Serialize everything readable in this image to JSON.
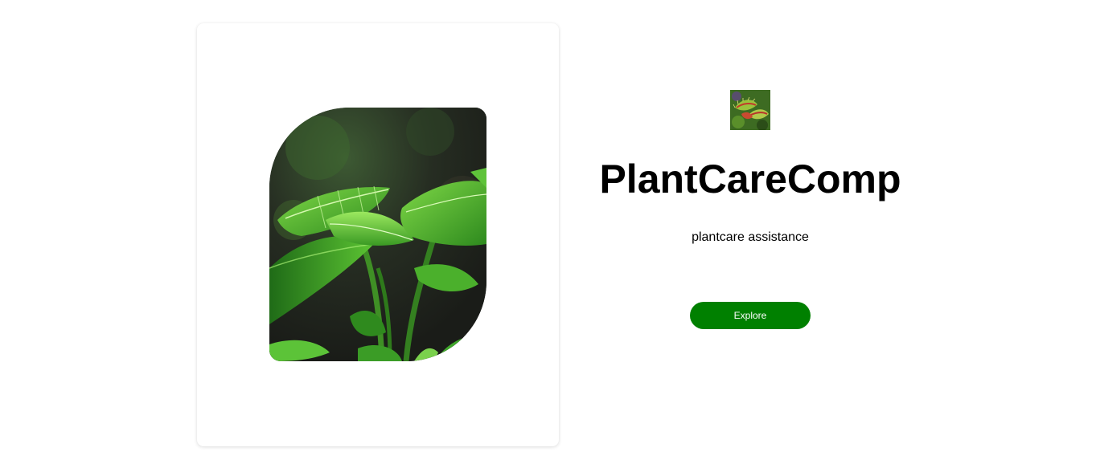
{
  "hero": {
    "image_icon": "plant-leaves-photo"
  },
  "brand": {
    "logo_icon": "venus-flytrap-logo",
    "title": "PlantCareComp",
    "subtitle": "plantcare assistance"
  },
  "actions": {
    "explore_label": "Explore"
  },
  "colors": {
    "accent": "#008000",
    "text": "#000000",
    "background": "#ffffff"
  }
}
